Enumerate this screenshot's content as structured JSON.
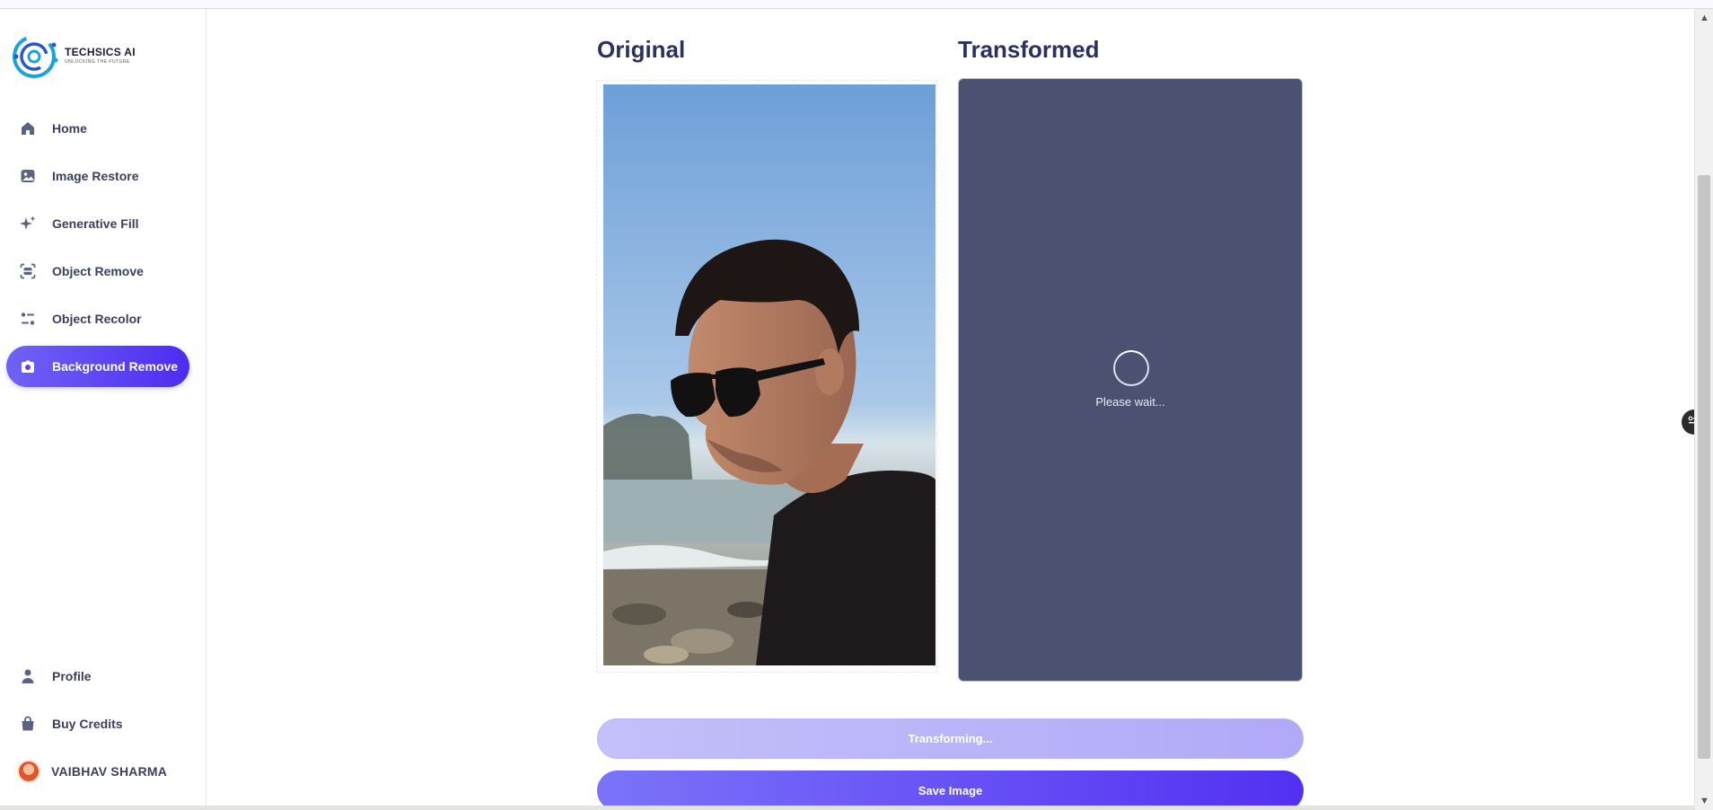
{
  "brand": {
    "name": "TECHSICS AI",
    "tagline": "UNLOCKING THE FUTURE",
    "accent_color": "#5a3ff3"
  },
  "sidebar": {
    "items": [
      {
        "label": "Home",
        "icon": "home-icon",
        "active": false
      },
      {
        "label": "Image Restore",
        "icon": "image-icon",
        "active": false
      },
      {
        "label": "Generative Fill",
        "icon": "sparkles-icon",
        "active": false
      },
      {
        "label": "Object Remove",
        "icon": "scan-icon",
        "active": false
      },
      {
        "label": "Object Recolor",
        "icon": "filter-icon",
        "active": false
      },
      {
        "label": "Background Remove",
        "icon": "camera-icon",
        "active": true
      }
    ],
    "bottom": [
      {
        "label": "Profile",
        "icon": "user-icon"
      },
      {
        "label": "Buy Credits",
        "icon": "bag-icon"
      }
    ],
    "user_name": "VAIBHAV SHARMA"
  },
  "main": {
    "original_title": "Original",
    "transformed_title": "Transformed",
    "loading_text": "Please wait...",
    "transform_button": "Transforming...",
    "save_button": "Save Image"
  }
}
